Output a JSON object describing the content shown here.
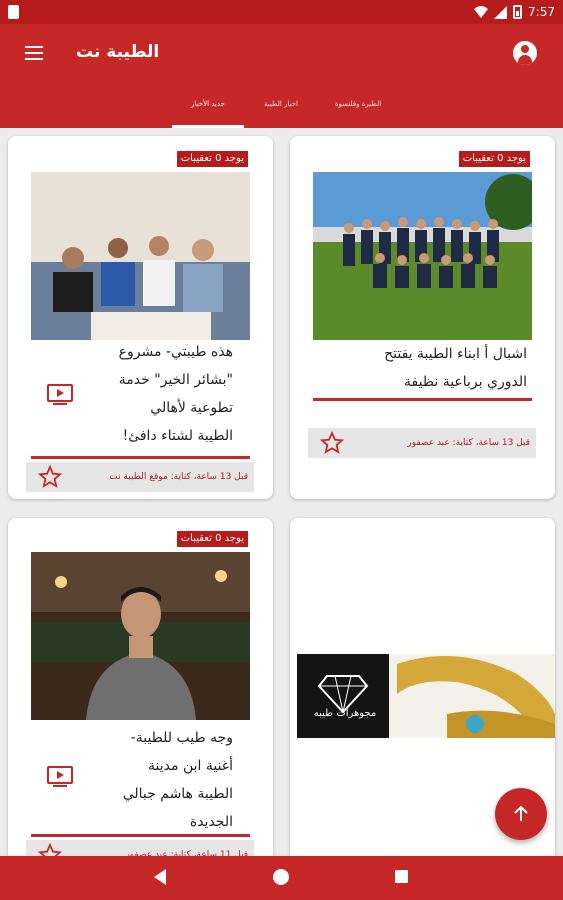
{
  "status_bar": {
    "time": "7:57"
  },
  "app_bar": {
    "title": "الطيبة نت",
    "tabs": [
      {
        "label": "جديد الأخبار",
        "active": true
      },
      {
        "label": "اخبار الطيبة",
        "active": false
      },
      {
        "label": "الطيرة وقلنسوة",
        "active": false
      }
    ]
  },
  "cards": [
    {
      "badge": "يوجد 0 تعقيبات",
      "title_lines": [
        "اشبال أ ابناء الطيبة يفتتح",
        "الدوري برباعية نظيفة"
      ],
      "meta": "قبل 13 ساعة، كتابة: عبد عصفور",
      "photo": "football team photo"
    },
    {
      "badge": "يوجد 0 تعقيبات",
      "title_lines": [
        "هذه طيبتي- مشروع",
        "\"بشائر الخير\" خدمة",
        "تطوعية لأهالي",
        "الطيبة لشتاء دافئ!"
      ],
      "meta": "قبل 13 ساعة، كتابة: موقع الطيبة نت",
      "photo": "men sitting on sofa",
      "has_video": true
    },
    {
      "badge": "",
      "ad_text": "مجوهرات طيبه",
      "photo": "jewelry advertisement"
    },
    {
      "badge": "يوجد 0 تعقيبات",
      "title_lines": [
        "وجه طيب للطيبة-",
        "أغنية ابن مدينة",
        "الطيبة هاشم جبالي",
        "الجديدة"
      ],
      "meta": "قبل 11 ساعة، كتابة: عبد عصفور",
      "photo": "portrait of man",
      "has_video": true
    }
  ],
  "colors": {
    "primary": "#c62828",
    "dark": "#b71c1c"
  }
}
